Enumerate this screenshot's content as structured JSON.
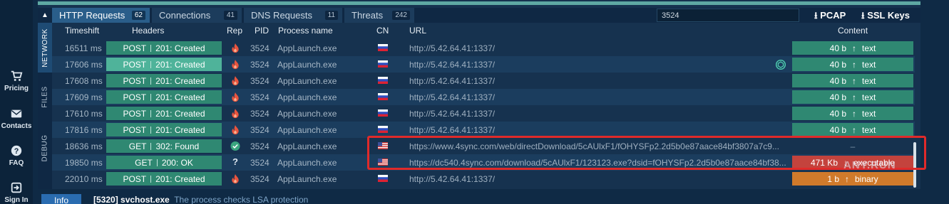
{
  "sidebar": [
    {
      "icon": "cart-icon",
      "label": "Pricing"
    },
    {
      "icon": "mail-icon",
      "label": "Contacts"
    },
    {
      "icon": "help-icon",
      "label": "FAQ"
    },
    {
      "icon": "signin-icon",
      "label": "Sign In"
    }
  ],
  "tabs": [
    {
      "label": "HTTP Requests",
      "count": "62"
    },
    {
      "label": "Connections",
      "count": "41"
    },
    {
      "label": "DNS Requests",
      "count": "11"
    },
    {
      "label": "Threats",
      "count": "242"
    }
  ],
  "search_value": "3524",
  "buttons": {
    "pcap": "PCAP",
    "ssl": "SSL Keys"
  },
  "vertical_tabs": [
    "NETWORK",
    "FILES",
    "DEBUG"
  ],
  "columns": {
    "timeshift": "Timeshift",
    "headers": "Headers",
    "rep": "Rep",
    "pid": "PID",
    "process": "Process name",
    "cn": "CN",
    "url": "URL",
    "content": "Content"
  },
  "rows": [
    {
      "timeshift": "16511 ms",
      "method": "POST",
      "status": "201: Created",
      "rep": "fire",
      "pid": "3524",
      "process": "AppLaunch.exe",
      "cn": "ru",
      "url": "http://5.42.64.41:1337/",
      "size": "40 b",
      "dir": "↑",
      "ctype": "text",
      "content_style": "green"
    },
    {
      "timeshift": "17606 ms",
      "method": "POST",
      "status": "201: Created",
      "rep": "fire",
      "pid": "3524",
      "process": "AppLaunch.exe",
      "cn": "ru",
      "url": "http://5.42.64.41:1337/",
      "size": "40 b",
      "dir": "↑",
      "ctype": "text",
      "content_style": "green"
    },
    {
      "timeshift": "17608 ms",
      "method": "POST",
      "status": "201: Created",
      "rep": "fire",
      "pid": "3524",
      "process": "AppLaunch.exe",
      "cn": "ru",
      "url": "http://5.42.64.41:1337/",
      "size": "40 b",
      "dir": "↑",
      "ctype": "text",
      "content_style": "green"
    },
    {
      "timeshift": "17609 ms",
      "method": "POST",
      "status": "201: Created",
      "rep": "fire",
      "pid": "3524",
      "process": "AppLaunch.exe",
      "cn": "ru",
      "url": "http://5.42.64.41:1337/",
      "size": "40 b",
      "dir": "↑",
      "ctype": "text",
      "content_style": "green"
    },
    {
      "timeshift": "17610 ms",
      "method": "POST",
      "status": "201: Created",
      "rep": "fire",
      "pid": "3524",
      "process": "AppLaunch.exe",
      "cn": "ru",
      "url": "http://5.42.64.41:1337/",
      "size": "40 b",
      "dir": "↑",
      "ctype": "text",
      "content_style": "green"
    },
    {
      "timeshift": "17816 ms",
      "method": "POST",
      "status": "201: Created",
      "rep": "fire",
      "pid": "3524",
      "process": "AppLaunch.exe",
      "cn": "ru",
      "url": "http://5.42.64.41:1337/",
      "size": "40 b",
      "dir": "↑",
      "ctype": "text",
      "content_style": "green"
    },
    {
      "timeshift": "18636 ms",
      "method": "GET",
      "status": "302: Found",
      "rep": "check",
      "pid": "3524",
      "process": "AppLaunch.exe",
      "cn": "us",
      "url": "https://www.4sync.com/web/directDownload/5cAUlxF1/fOHYSFp2.2d5b0e87aace84bf3807a7c9...",
      "size": "–",
      "dir": "",
      "ctype": "",
      "content_style": "empty"
    },
    {
      "timeshift": "19850 ms",
      "method": "GET",
      "status": "200: OK",
      "rep": "unknown",
      "pid": "3524",
      "process": "AppLaunch.exe",
      "cn": "us",
      "url": "https://dc540.4sync.com/download/5cAUlxF1/123123.exe?dsid=fOHYSFp2.2d5b0e87aace84bf38...",
      "size": "471 Kb",
      "dir": "↓",
      "ctype": "executable",
      "content_style": "red"
    },
    {
      "timeshift": "22010 ms",
      "method": "POST",
      "status": "201: Created",
      "rep": "fire",
      "pid": "3524",
      "process": "AppLaunch.exe",
      "cn": "ru",
      "url": "http://5.42.64.41:1337/",
      "size": "1 b",
      "dir": "↑",
      "ctype": "binary",
      "content_style": "orange"
    }
  ],
  "highlighted_row": 1,
  "bottom": {
    "info_label": "Info",
    "process": "[5320] svchost.exe",
    "message": "The process checks LSA protection"
  },
  "watermark": "ANY.RUN",
  "colors": {
    "accent_teal": "#2f8872",
    "danger": "#c4433d",
    "warning": "#d07a2b",
    "highlight_box": "#e02a2a"
  }
}
